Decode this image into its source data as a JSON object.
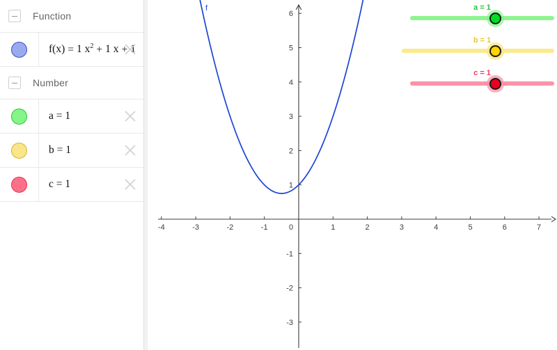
{
  "app": {
    "name": "GeoGebra Graphing Calculator"
  },
  "algebra_panel": {
    "groups": [
      {
        "title": "Function",
        "collapse_icon": "minus-icon",
        "rows": [
          {
            "id": "f",
            "marker_color": "#99aaee",
            "marker_border": "#3f51c8",
            "marker_name": "function-visibility-toggle",
            "kind": "function",
            "label_prefix": "f(x)",
            "equals": "=",
            "coef_a": "1",
            "term_a": "x",
            "exponent": "2",
            "op1": "+",
            "coef_b": "1",
            "term_b": "x",
            "op2": "+",
            "coef_c": "1",
            "full_text": "f(x) = 1 x² + 1 x + 1",
            "close_icon": "close-icon"
          }
        ]
      },
      {
        "title": "Number",
        "collapse_icon": "minus-icon",
        "rows": [
          {
            "id": "a",
            "marker_color": "#85f58a",
            "marker_border": "#27c43a",
            "marker_name": "slider-a-visibility-toggle",
            "kind": "number",
            "full_text": "a = 1",
            "close_icon": "close-icon"
          },
          {
            "id": "b",
            "marker_color": "#f9e58a",
            "marker_border": "#d7b720",
            "marker_name": "slider-b-visibility-toggle",
            "kind": "number",
            "full_text": "b = 1",
            "close_icon": "close-icon"
          },
          {
            "id": "c",
            "marker_color": "#fb7189",
            "marker_border": "#e8304f",
            "marker_name": "slider-c-visibility-toggle",
            "kind": "number",
            "full_text": "c = 1",
            "close_icon": "close-icon"
          }
        ]
      }
    ]
  },
  "graphics": {
    "curve_label": "f",
    "curve_color": "#1a44d6",
    "axis_color": "#3c3c3c",
    "x_axis_ticks": [
      "-4",
      "-3",
      "-2",
      "-1",
      "0",
      "1",
      "2",
      "3",
      "4",
      "5",
      "6",
      "7"
    ],
    "y_axis_ticks": [
      "6",
      "5",
      "4",
      "3",
      "2",
      "1",
      "-1",
      "-2",
      "-3"
    ],
    "origin_label": "0"
  },
  "sliders": [
    {
      "id": "a",
      "label": "a = 1",
      "value": "1",
      "track_color": "#8df58f",
      "handle_fill": "#00dd22",
      "handle_border": "#1a1a1a",
      "halo_color": "rgba(120,245,130,0.62)",
      "label_color": "#24c13a"
    },
    {
      "id": "b",
      "label": "b = 1",
      "value": "1",
      "track_color": "#fbea8d",
      "handle_fill": "#ffd400",
      "handle_border": "#1a1a1a",
      "halo_color": "rgba(250,232,137,0.85)",
      "label_color": "#e8c723"
    },
    {
      "id": "c",
      "label": "c = 1",
      "value": "1",
      "track_color": "#fb93a6",
      "handle_fill": "#e8001e",
      "handle_border": "#1a1a1a",
      "halo_color": "rgba(251,147,166,0.75)",
      "label_color": "#f23a57"
    }
  ],
  "chart_data": {
    "type": "line",
    "title": "",
    "xlabel": "",
    "ylabel": "",
    "xlim": [
      -4.35,
      7.4
    ],
    "ylim": [
      -3.55,
      6.4
    ],
    "grid": false,
    "xticks": [
      -4,
      -3,
      -2,
      -1,
      0,
      1,
      2,
      3,
      4,
      5,
      6,
      7
    ],
    "yticks": [
      -3,
      -2,
      -1,
      1,
      2,
      3,
      4,
      5,
      6
    ],
    "series": [
      {
        "name": "f",
        "expression": "f(x) = 1 x^2 + 1 x + 1",
        "coefficients": {
          "a": 1,
          "b": 1,
          "c": 1
        },
        "color": "#1a44d6",
        "vertex": [
          -0.5,
          0.75
        ],
        "points": [
          [
            -2.5,
            4.75
          ],
          [
            -2.25,
            3.8125
          ],
          [
            -2.0,
            3.0
          ],
          [
            -1.75,
            2.3125
          ],
          [
            -1.5,
            1.75
          ],
          [
            -1.25,
            1.3125
          ],
          [
            -1.0,
            1.0
          ],
          [
            -0.75,
            0.8125
          ],
          [
            -0.5,
            0.75
          ],
          [
            -0.25,
            0.8125
          ],
          [
            0.0,
            1.0
          ],
          [
            0.25,
            1.3125
          ],
          [
            0.5,
            1.75
          ],
          [
            0.75,
            2.3125
          ],
          [
            1.0,
            3.0
          ],
          [
            1.25,
            3.8125
          ],
          [
            1.5,
            4.75
          ],
          [
            1.75,
            5.8125
          ],
          [
            2.0,
            7.0
          ]
        ]
      }
    ]
  }
}
